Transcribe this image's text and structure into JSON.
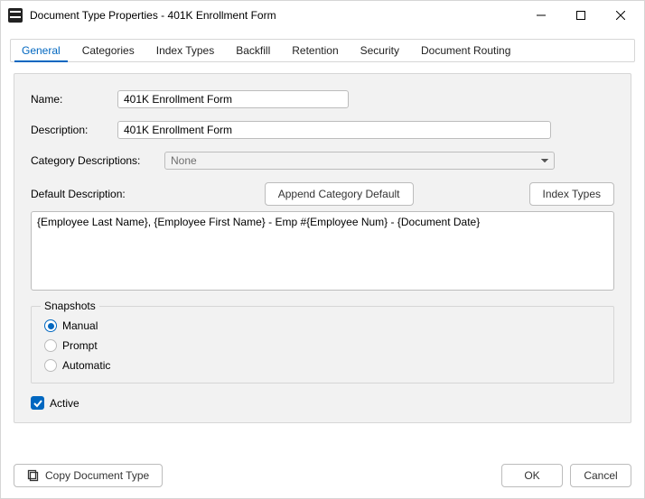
{
  "window": {
    "title": "Document Type Properties  - 401K Enrollment Form"
  },
  "tabs": {
    "general": "General",
    "categories": "Categories",
    "indextypes": "Index Types",
    "backfill": "Backfill",
    "retention": "Retention",
    "security": "Security",
    "routing": "Document Routing"
  },
  "form": {
    "name_label": "Name:",
    "name_value": "401K Enrollment Form",
    "desc_label": "Description:",
    "desc_value": "401K Enrollment Form",
    "catdesc_label": "Category Descriptions:",
    "catdesc_selected": "None",
    "defaultdesc_label": "Default Description:",
    "append_btn": "Append Category Default",
    "indextypes_btn": "Index Types",
    "defaultdesc_value": "{Employee Last Name}, {Employee First Name} - Emp #{Employee Num} - {Document Date}"
  },
  "snapshots": {
    "legend": "Snapshots",
    "manual": "Manual",
    "prompt": "Prompt",
    "automatic": "Automatic",
    "selected": "manual"
  },
  "active": {
    "label": "Active",
    "checked": true
  },
  "footer": {
    "copy": "Copy Document Type",
    "ok": "OK",
    "cancel": "Cancel"
  }
}
